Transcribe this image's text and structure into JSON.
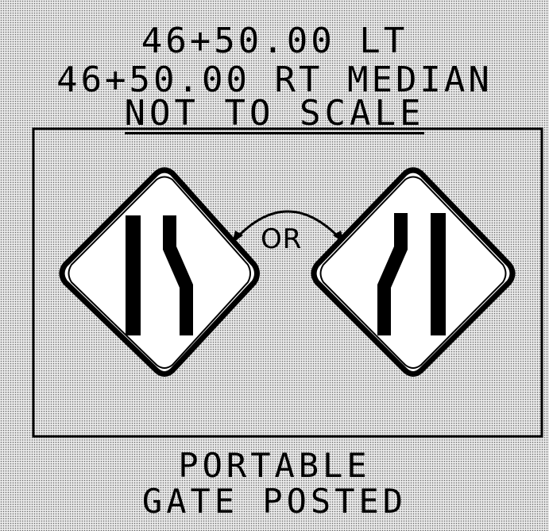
{
  "header": {
    "line1": "46+50.00 LT",
    "line2": "46+50.00 RT MEDIAN",
    "line3": "NOT TO SCALE"
  },
  "signs": {
    "left": {
      "icon": "lane-shift-right-narrows-icon"
    },
    "right": {
      "icon": "lane-shift-left-narrows-icon"
    },
    "connector_label": "OR"
  },
  "footer": {
    "line1": "PORTABLE",
    "line2": "GATE POSTED"
  },
  "colors": {
    "ink": "#000000",
    "sign_face": "#ffffff",
    "background": "#e9e9e9"
  }
}
